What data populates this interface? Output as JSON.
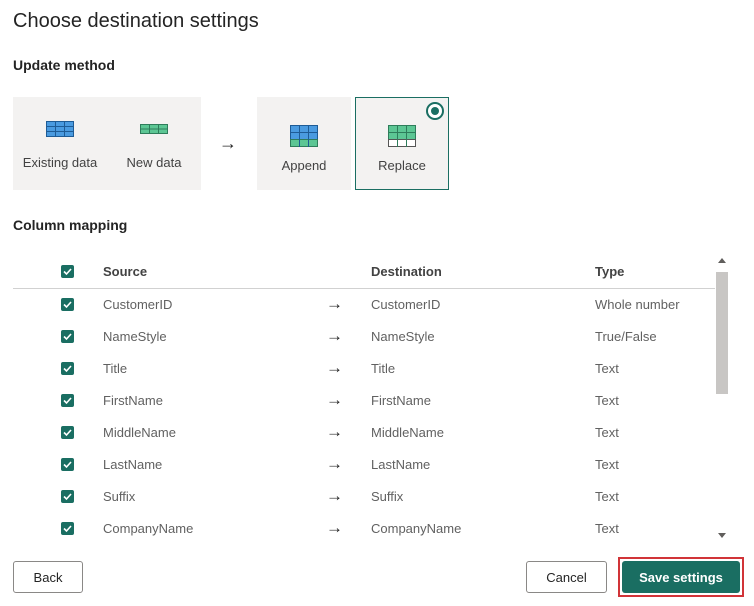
{
  "page": {
    "title": "Choose destination settings"
  },
  "update_method": {
    "label": "Update method",
    "sources": [
      {
        "label": "Existing data",
        "icon": "table-icon"
      },
      {
        "label": "New data",
        "icon": "table-icon"
      }
    ],
    "options": [
      {
        "label": "Append",
        "icon": "append-table-icon",
        "selected": false
      },
      {
        "label": "Replace",
        "icon": "replace-table-icon",
        "selected": true
      }
    ]
  },
  "column_mapping": {
    "label": "Column mapping",
    "headers": {
      "source": "Source",
      "destination": "Destination",
      "type": "Type"
    },
    "rows": [
      {
        "source": "CustomerID",
        "destination": "CustomerID",
        "type": "Whole number",
        "checked": true
      },
      {
        "source": "NameStyle",
        "destination": "NameStyle",
        "type": "True/False",
        "checked": true
      },
      {
        "source": "Title",
        "destination": "Title",
        "type": "Text",
        "checked": true
      },
      {
        "source": "FirstName",
        "destination": "FirstName",
        "type": "Text",
        "checked": true
      },
      {
        "source": "MiddleName",
        "destination": "MiddleName",
        "type": "Text",
        "checked": true
      },
      {
        "source": "LastName",
        "destination": "LastName",
        "type": "Text",
        "checked": true
      },
      {
        "source": "Suffix",
        "destination": "Suffix",
        "type": "Text",
        "checked": true
      },
      {
        "source": "CompanyName",
        "destination": "CompanyName",
        "type": "Text",
        "checked": true
      }
    ]
  },
  "buttons": {
    "back": "Back",
    "cancel": "Cancel",
    "save": "Save settings"
  },
  "colors": {
    "accent": "#1a6e62",
    "highlight": "#d13438",
    "blue_table": "#4a9be0",
    "green_table": "#5cc694"
  }
}
